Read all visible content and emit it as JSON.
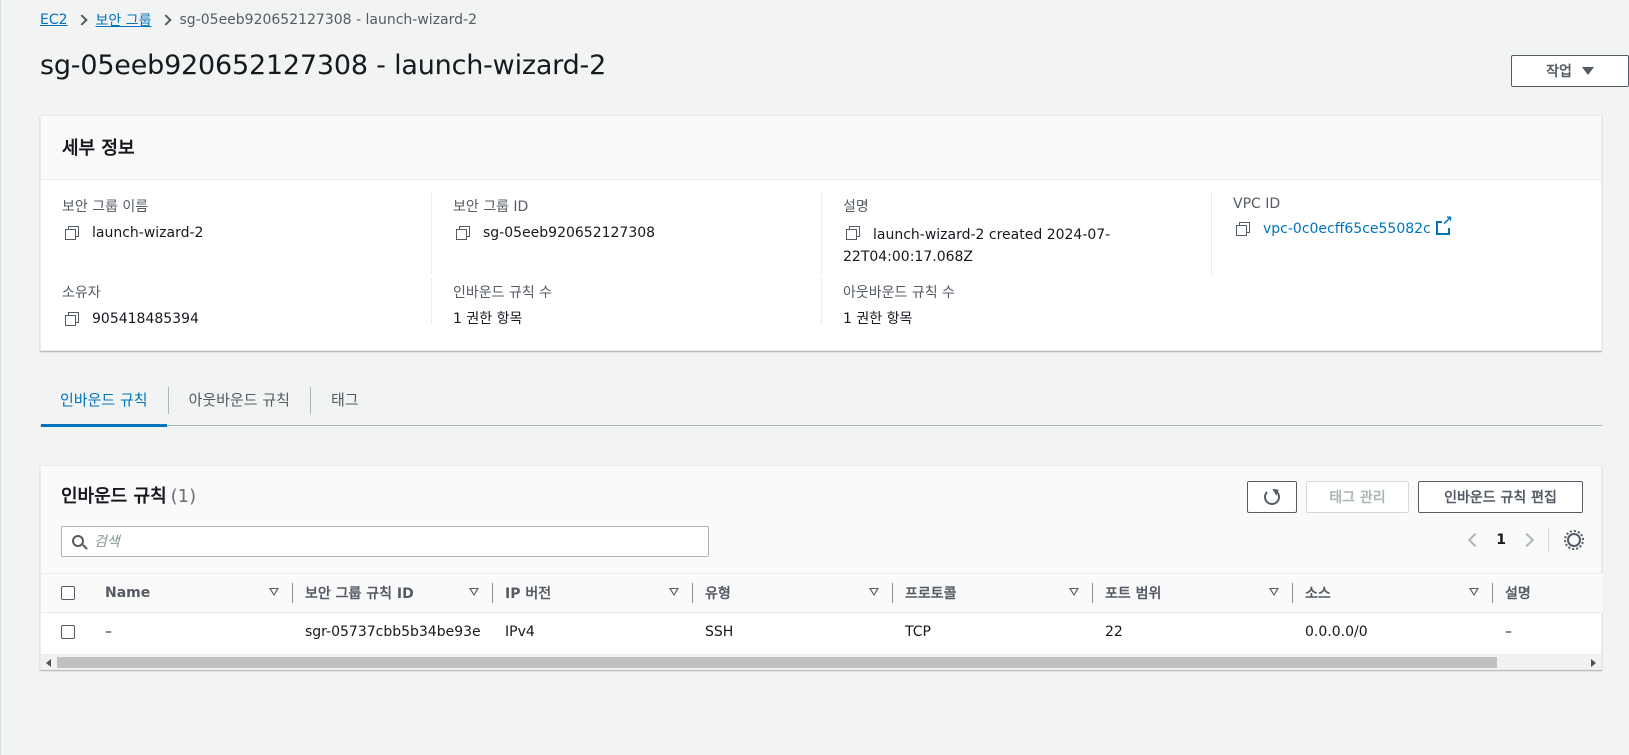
{
  "breadcrumb": {
    "items": [
      "EC2",
      "보안 그룹"
    ],
    "current": "sg-05eeb920652127308 - launch-wizard-2"
  },
  "page": {
    "title": "sg-05eeb920652127308 - launch-wizard-2",
    "actions_label": "작업"
  },
  "details": {
    "title": "세부 정보",
    "sg_name_label": "보안 그룹 이름",
    "sg_name": "launch-wizard-2",
    "sg_id_label": "보안 그룹 ID",
    "sg_id": "sg-05eeb920652127308",
    "description_label": "설명",
    "description": "launch-wizard-2 created 2024-07-22T04:00:17.068Z",
    "vpc_label": "VPC ID",
    "vpc_id": "vpc-0c0ecff65ce55082c",
    "owner_label": "소유자",
    "owner": "905418485394",
    "inbound_count_label": "인바운드 규칙 수",
    "inbound_count": "1 권한 항목",
    "outbound_count_label": "아웃바운드 규칙 수",
    "outbound_count": "1 권한 항목"
  },
  "tabs": [
    {
      "label": "인바운드 규칙",
      "active": true
    },
    {
      "label": "아웃바운드 규칙",
      "active": false
    },
    {
      "label": "태그",
      "active": false
    }
  ],
  "rules": {
    "title": "인바운드 규칙",
    "count": "(1)",
    "manage_tags_label": "태그 관리",
    "edit_rules_label": "인바운드 규칙 편집",
    "search_placeholder": "검색",
    "current_page": "1",
    "columns": [
      "Name",
      "보안 그룹 규칙 ID",
      "IP 버전",
      "유형",
      "프로토콜",
      "포트 범위",
      "소스",
      "설명"
    ],
    "rows": [
      [
        "–",
        "sgr-05737cbb5b34be93e",
        "IPv4",
        "SSH",
        "TCP",
        "22",
        "0.0.0.0/0",
        "–"
      ]
    ]
  },
  "colors": {
    "link": "#0073bb",
    "text": "#16191f",
    "muted": "#545b64",
    "background": "#f2f3f3"
  }
}
